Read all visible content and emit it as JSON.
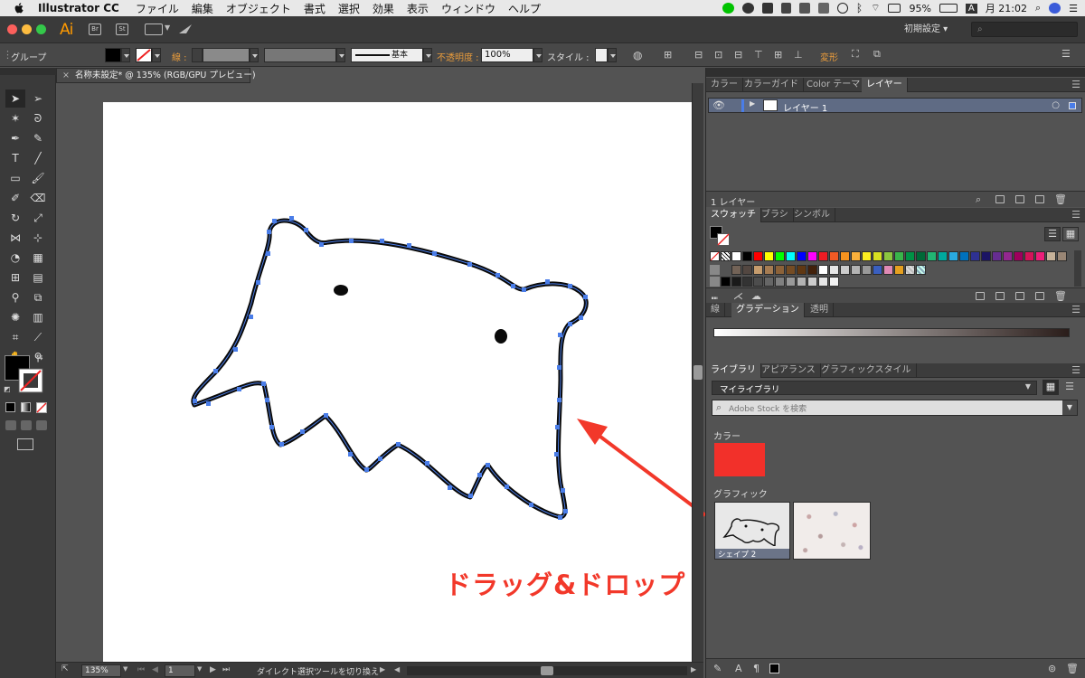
{
  "menubar": {
    "app_name": "Illustrator CC",
    "items": [
      "ファイル",
      "編集",
      "オブジェクト",
      "書式",
      "選択",
      "効果",
      "表示",
      "ウィンドウ",
      "ヘルプ"
    ],
    "battery": "95%",
    "clock": "月 21:02",
    "input_mode": "A"
  },
  "appbar": {
    "logo": "Ai",
    "bridge_label": "Br",
    "stock_label": "St",
    "workspace": "初期設定",
    "search_placeholder": ""
  },
  "controlbar": {
    "selection_label": "グループ",
    "stroke_label": "線 :",
    "brush_style": "基本",
    "opacity_label": "不透明度 :",
    "opacity_value": "100%",
    "style_label": "スタイル :",
    "transform_label": "変形"
  },
  "document": {
    "tab_title": "名称未設定* @ 135% (RGB/GPU プレビュー)",
    "annotation": "ドラッグ&ドロップ",
    "zoom": "135%",
    "artboard_number": "1",
    "status_text": "ダイレクト選択ツールを切り換え"
  },
  "panels": {
    "top_tabs": [
      "カラー",
      "カラーガイド",
      "Color テーマ",
      "レイヤー"
    ],
    "layer_name": "レイヤー 1",
    "layer_count": "1 レイヤー",
    "swatch_tabs": [
      "スウォッチ",
      "ブラシ",
      "シンボル"
    ],
    "gradient_tabs": [
      "線",
      "グラデーション",
      "透明"
    ],
    "library_tabs": [
      "ライブラリ",
      "アピアランス",
      "グラフィックスタイル"
    ],
    "library_name": "マイライブラリ",
    "stock_search_placeholder": "Adobe Stock を検索",
    "colors_heading": "カラー",
    "graphics_heading": "グラフィック",
    "graphic_item_name": "シェイプ 2",
    "library_color": "#f2302a"
  },
  "swatches": {
    "row1": [
      "#ffffff",
      "#000000",
      "#ff0000",
      "#ffff00",
      "#00ff00",
      "#00ffff",
      "#0000ff",
      "#ff00ff",
      "#ed1c24",
      "#f15a24",
      "#f7931e",
      "#fbb03b",
      "#fcee21",
      "#d9e021",
      "#8cc63f",
      "#39b54a",
      "#009245",
      "#006837",
      "#22b573",
      "#00a99d",
      "#29abe2",
      "#0071bc",
      "#2e3192",
      "#1b1464",
      "#662d91",
      "#93278f",
      "#9e005d",
      "#d4145a",
      "#ed1e79",
      "#c7b299",
      "#998675"
    ],
    "row2": [
      "#736357",
      "#534741",
      "#c69c6d",
      "#a67c52",
      "#8c6239",
      "#754c24",
      "#603813",
      "#42210b",
      "#ffffff",
      "#e6e6e6",
      "#cccccc",
      "#b3b3b3",
      "#999999"
    ],
    "row3": [
      "#000000",
      "#1a1a1a",
      "#333333",
      "#4d4d4d",
      "#666666",
      "#808080",
      "#999999",
      "#b3b3b3",
      "#cccccc",
      "#e6e6e6",
      "#f2f2f2"
    ]
  }
}
